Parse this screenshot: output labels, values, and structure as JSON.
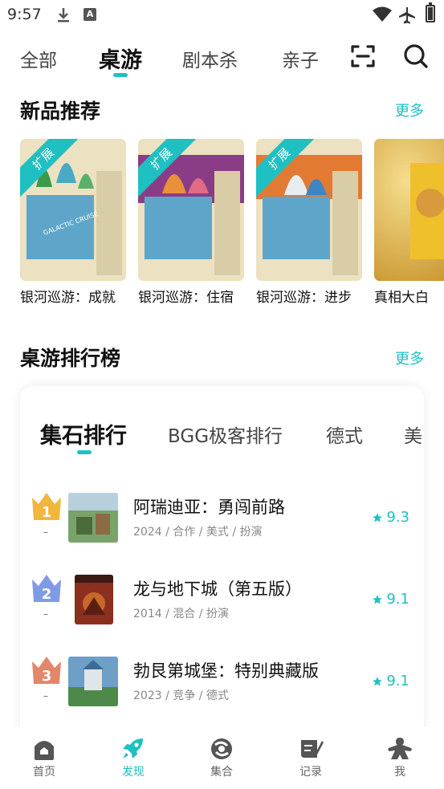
{
  "status": {
    "time": "9:57",
    "a_badge": "A"
  },
  "top_tabs": [
    {
      "label": "全部",
      "active": false
    },
    {
      "label": "桌游",
      "active": true
    },
    {
      "label": "剧本杀",
      "active": false
    },
    {
      "label": "亲子",
      "active": false
    }
  ],
  "new_section": {
    "title": "新品推荐",
    "more": "更多",
    "cards": [
      {
        "name": "银河巡游：成就",
        "badge": "扩展"
      },
      {
        "name": "银河巡游：住宿",
        "badge": "扩展"
      },
      {
        "name": "银河巡游：进步",
        "badge": "扩展"
      },
      {
        "name": "真相大白",
        "badge": ""
      }
    ]
  },
  "ranking": {
    "title": "桌游排行榜",
    "more": "更多",
    "tabs": [
      {
        "label": "集石排行",
        "active": true
      },
      {
        "label": "BGG极客排行",
        "active": false
      },
      {
        "label": "德式",
        "active": false
      },
      {
        "label": "美",
        "active": false
      }
    ],
    "items": [
      {
        "rank": "1",
        "dash": "–",
        "title": "阿瑞迪亚：勇闯前路",
        "meta": "2024 / 合作 / 美式 / 扮演",
        "score": "9.3"
      },
      {
        "rank": "2",
        "dash": "–",
        "title": "龙与地下城（第五版）",
        "meta": "2014 / 混合 / 扮演",
        "score": "9.1"
      },
      {
        "rank": "3",
        "dash": "–",
        "title": "勃艮第城堡：特别典藏版",
        "meta": "2023 / 竞争 / 德式",
        "score": "9.1"
      }
    ]
  },
  "bottom_nav": [
    {
      "label": "首页",
      "icon": "home-icon",
      "active": false
    },
    {
      "label": "发现",
      "icon": "rocket-icon",
      "active": true
    },
    {
      "label": "集合",
      "icon": "collection-icon",
      "active": false
    },
    {
      "label": "记录",
      "icon": "record-icon",
      "active": false
    },
    {
      "label": "我",
      "icon": "meeple-icon",
      "active": false
    }
  ],
  "colors": {
    "accent": "#1fc0c2",
    "gold": "#f2b63c",
    "silver": "#7f9be6",
    "bronze": "#e3876a"
  }
}
